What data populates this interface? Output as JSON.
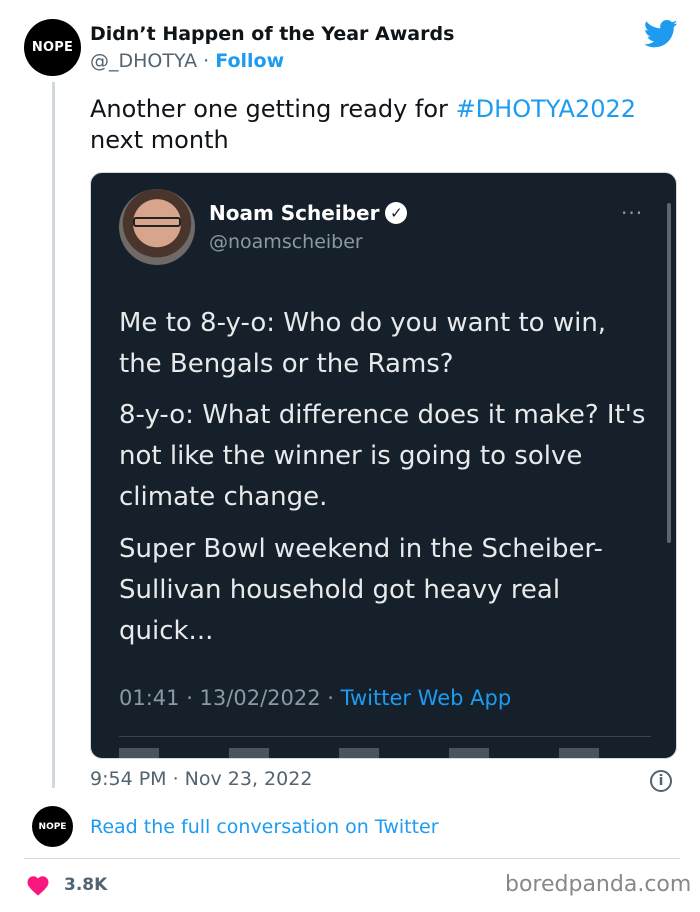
{
  "author": {
    "avatar_text": "NOPE",
    "name": "Didn’t Happen of the Year Awards",
    "handle": "@_DHOTYA",
    "separator": "·",
    "follow_label": "Follow"
  },
  "tweet": {
    "text_before": "Another one getting ready for ",
    "hashtag": "#DHOTYA2022",
    "text_after": " next month",
    "timestamp": "9:54 PM · Nov 23, 2022"
  },
  "embedded": {
    "name": "Noam Scheiber",
    "handle": "@noamscheiber",
    "more_label": "···",
    "paragraphs": [
      "Me to 8-y-o: Who do you want to win, the Bengals or the Rams?",
      "8-y-o: What difference does it make? It's not like the winner is going to solve climate change.",
      "Super Bowl weekend in the Scheiber-Sullivan household got heavy real quick..."
    ],
    "meta_date": "01:41 · 13/02/2022 · ",
    "meta_app": "Twitter Web App"
  },
  "footer": {
    "small_avatar_text": "NOPE",
    "read_link": "Read the full conversation on Twitter",
    "like_count": "3.8K",
    "watermark": "boredpanda.com"
  },
  "icons": {
    "twitter": "twitter-bird-icon",
    "verified": "verified-badge-icon",
    "info": "info-icon",
    "heart": "heart-icon"
  },
  "colors": {
    "accent": "#1d9bf0",
    "heart": "#f91880",
    "embed_bg": "#15202b"
  }
}
